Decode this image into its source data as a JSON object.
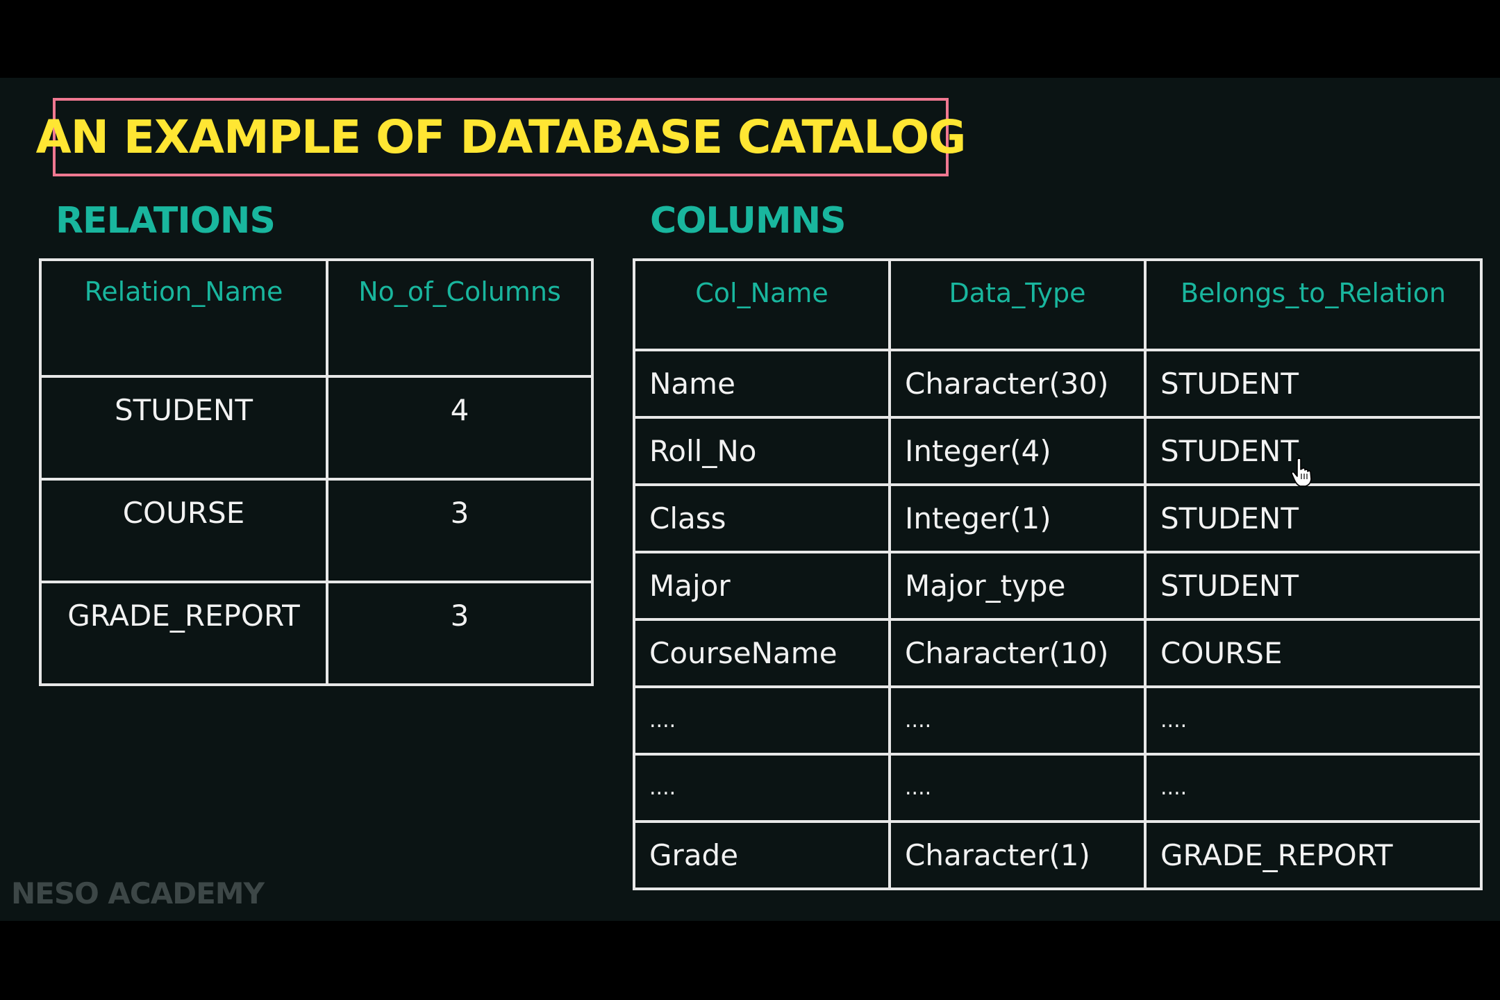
{
  "title": "AN EXAMPLE OF DATABASE CATALOG",
  "relations": {
    "heading": "RELATIONS",
    "headers": [
      "Relation_Name",
      "No_of_Columns"
    ],
    "rows": [
      [
        "STUDENT",
        "4"
      ],
      [
        "COURSE",
        "3"
      ],
      [
        "GRADE_REPORT",
        "3"
      ]
    ]
  },
  "columns": {
    "heading": "COLUMNS",
    "headers": [
      "Col_Name",
      "Data_Type",
      "Belongs_to_Relation"
    ],
    "rows": [
      [
        "Name",
        "Character(30)",
        "STUDENT"
      ],
      [
        "Roll_No",
        "Integer(4)",
        "STUDENT"
      ],
      [
        "Class",
        "Integer(1)",
        "STUDENT"
      ],
      [
        "Major",
        "Major_type",
        "STUDENT"
      ],
      [
        "CourseName",
        "Character(10)",
        "COURSE"
      ],
      [
        "....",
        "....",
        "...."
      ],
      [
        "....",
        "....",
        "...."
      ],
      [
        "Grade",
        "Character(1)",
        "GRADE_REPORT"
      ]
    ]
  },
  "watermark": "NESO ACADEMY",
  "colors": {
    "title": "#ffe633",
    "title_border": "#f07891",
    "heading": "#19b69e",
    "background": "#0b1414"
  },
  "icons": {
    "cursor": "hand-pointer-icon"
  }
}
